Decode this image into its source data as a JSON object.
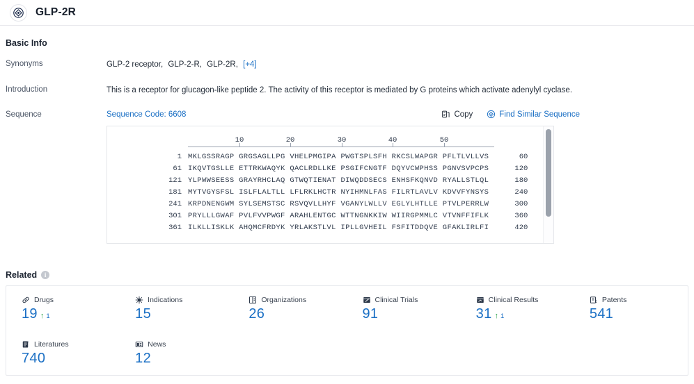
{
  "header": {
    "title": "GLP-2R",
    "avatar_icon": "target-diamond-icon"
  },
  "basic_info": {
    "section_title": "Basic Info",
    "rows": {
      "synonyms_label": "Synonyms",
      "synonyms": [
        "GLP-2 receptor,",
        "GLP-2-R,",
        "GLP-2R,"
      ],
      "synonyms_more": "[+4]",
      "introduction_label": "Introduction",
      "introduction": "This is a receptor for glucagon-like peptide 2. The activity of this receptor is mediated by G proteins which activate adenylyl cyclase.",
      "sequence_label": "Sequence"
    }
  },
  "sequence": {
    "code_label": "Sequence Code: 6608",
    "copy_label": "Copy",
    "copy_icon": "copy-icon",
    "find_similar_label": "Find Similar Sequence",
    "find_similar_icon": "find-similar-icon",
    "ruler": [
      10,
      20,
      30,
      40,
      50
    ],
    "lines": [
      {
        "start": "1",
        "chunks": "MKLGSSRAGP GRGSAGLLPG VHELPMGIPA PWGTSPLSFH RKCSLWAPGR PFLTLVLLVS",
        "end": "60"
      },
      {
        "start": "61",
        "chunks": "IKQVTGSLLE ETTRKWAQYK QACLRDLLKE PSGIFCNGTF DQYVCWPHSS PGNVSVPCPS",
        "end": "120"
      },
      {
        "start": "121",
        "chunks": "YLPWWSEESS GRAYRHCLAQ GTWQTIENAT DIWQDDSECS ENHSFKQNVD RYALLSTLQL",
        "end": "180"
      },
      {
        "start": "181",
        "chunks": "MYTVGYSFSL ISLFLALTLL LFLRKLHCTR NYIHMNLFAS FILRTLAVLV KDVVFYNSYS",
        "end": "240"
      },
      {
        "start": "241",
        "chunks": "KRPDNENGWM SYLSEMSTSC RSVQVLLHYF VGANYLWLLV EGLYLHTLLE PTVLPERRLW",
        "end": "300"
      },
      {
        "start": "301",
        "chunks": "PRYLLLGWAF PVLFVVPWGF ARAHLENTGC WTTNGNKKIW WIIRGPMMLC VTVNFFIFLK",
        "end": "360"
      },
      {
        "start": "361",
        "chunks": "ILKLLISKLK AHQMCFRDYK YRLAKSTLVL IPLLGVHEIL FSFITDDQVE GFAKLIRLFI",
        "end": "420"
      }
    ]
  },
  "related": {
    "section_title": "Related",
    "info_icon": "info-icon",
    "stats": [
      {
        "label": "Drugs",
        "icon": "pill-icon",
        "value": "19",
        "delta": "1"
      },
      {
        "label": "Indications",
        "icon": "virus-icon",
        "value": "15",
        "delta": ""
      },
      {
        "label": "Organizations",
        "icon": "building-icon",
        "value": "26",
        "delta": ""
      },
      {
        "label": "Clinical Trials",
        "icon": "clinical-trial-icon",
        "value": "91",
        "delta": ""
      },
      {
        "label": "Clinical Results",
        "icon": "clinical-result-icon",
        "value": "31",
        "delta": "1"
      },
      {
        "label": "Patents",
        "icon": "patent-icon",
        "value": "541",
        "delta": ""
      },
      {
        "label": "Literatures",
        "icon": "literature-icon",
        "value": "740",
        "delta": ""
      },
      {
        "label": "News",
        "icon": "news-icon",
        "value": "12",
        "delta": ""
      }
    ]
  },
  "colors": {
    "accent_blue": "#1a6fc4",
    "delta_green": "#1f9c3d",
    "text_dark": "#232c38",
    "label_grey": "#4b5565"
  }
}
